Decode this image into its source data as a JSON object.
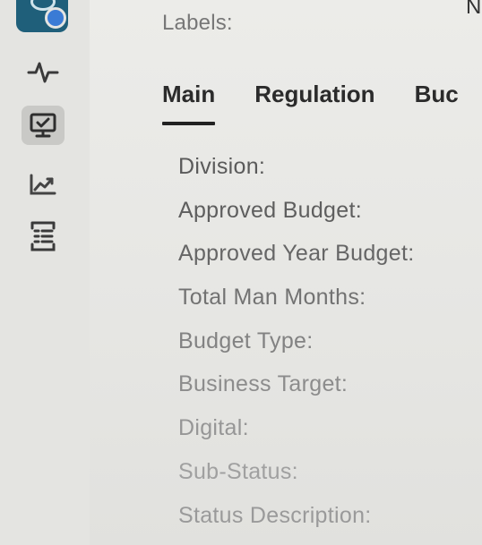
{
  "header": {
    "labels_caption": "Labels:",
    "top_right_fragment": "N"
  },
  "tabs": [
    {
      "label": "Main",
      "active": true
    },
    {
      "label": "Regulation",
      "active": false
    },
    {
      "label": "Buc",
      "active": false
    }
  ],
  "fields": [
    {
      "label": "Division:",
      "color": "#5a5a5a"
    },
    {
      "label": "Approved Budget:",
      "color": "#5e5e5e"
    },
    {
      "label": "Approved Year Budget:",
      "color": "#666666"
    },
    {
      "label": "Total Man Months:",
      "color": "#727272"
    },
    {
      "label": "Budget Type:",
      "color": "#828282"
    },
    {
      "label": "Business Target:",
      "color": "#8c8c8c"
    },
    {
      "label": "Digital:",
      "color": "#969696"
    },
    {
      "label": "Sub-Status:",
      "color": "#a0a0a0"
    },
    {
      "label": "Status Description:",
      "color": "#9a9a9a"
    }
  ],
  "sidebar": {
    "icons": [
      "activity-icon",
      "monitor-check-icon",
      "trend-chart-icon",
      "checklist-icon"
    ],
    "active_icon": "monitor-check-icon",
    "accent_color": "#1f5f7a"
  }
}
